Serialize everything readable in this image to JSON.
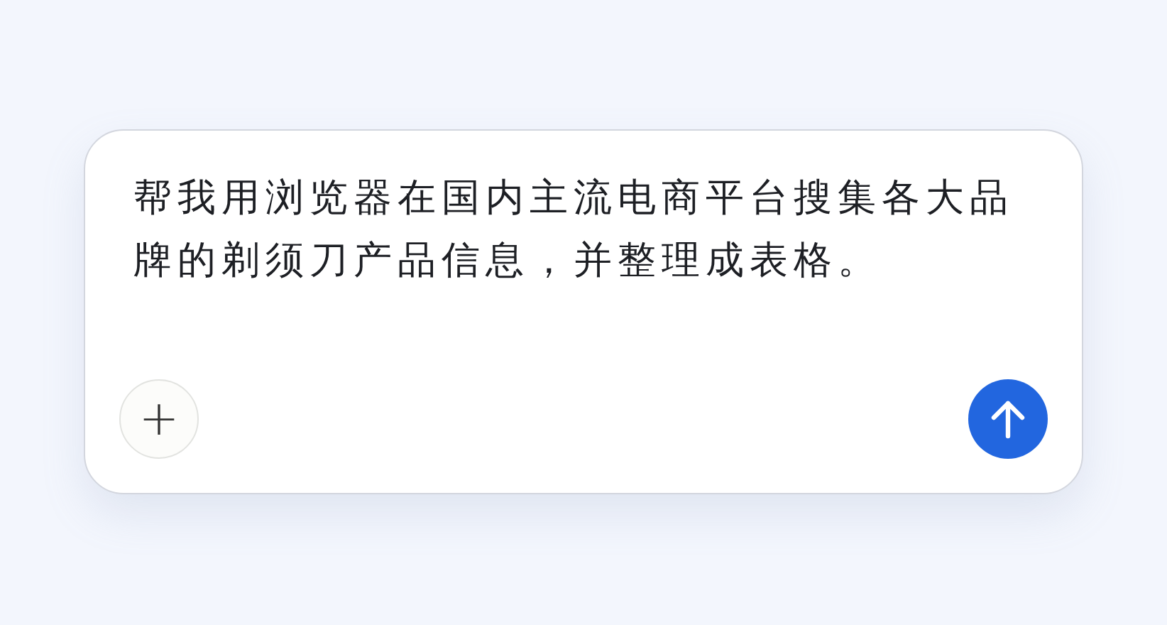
{
  "composer": {
    "value": "帮我用浏览器在国内主流电商平台搜集各大品牌的剃须刀产品信息，并整理成表格。",
    "add_button": {
      "label": "+"
    },
    "send_button": {
      "disabled": false
    }
  }
}
